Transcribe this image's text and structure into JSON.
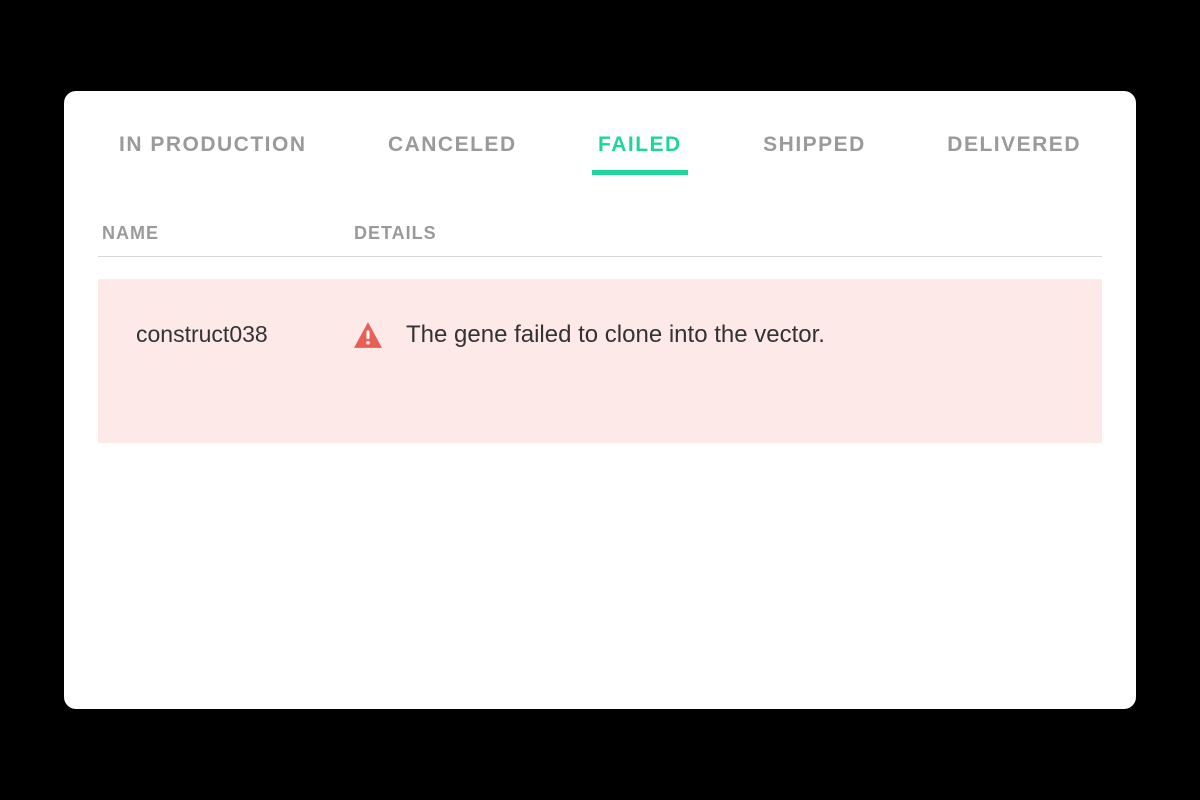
{
  "tabs": {
    "in_production": "IN PRODUCTION",
    "canceled": "CANCELED",
    "failed": "FAILED",
    "shipped": "SHIPPED",
    "delivered": "DELIVERED"
  },
  "active_tab": "failed",
  "columns": {
    "name": "NAME",
    "details": "DETAILS"
  },
  "rows": [
    {
      "name": "construct038",
      "details": "The gene failed to clone into the vector."
    }
  ],
  "colors": {
    "accent": "#1fd698",
    "error": "#e85f55",
    "row_bg": "#fde9e8"
  }
}
